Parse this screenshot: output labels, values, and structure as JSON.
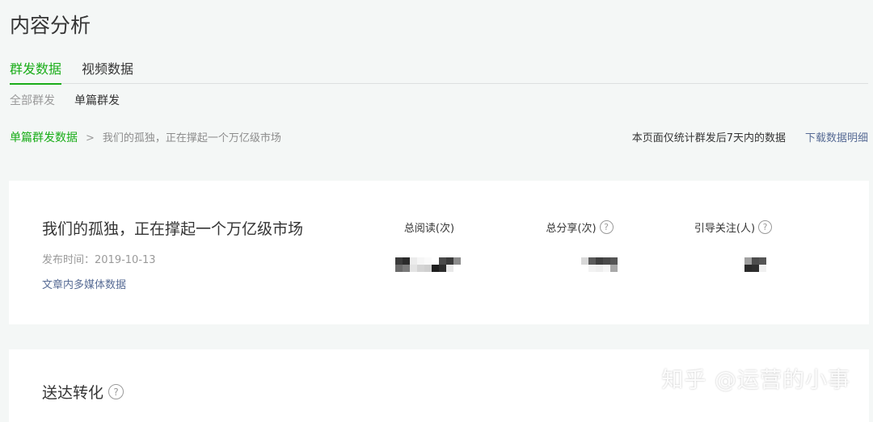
{
  "page": {
    "title": "内容分析"
  },
  "tabs": [
    {
      "label": "群发数据",
      "active": true
    },
    {
      "label": "视频数据",
      "active": false
    }
  ],
  "subtabs": [
    {
      "label": "全部群发",
      "active": false
    },
    {
      "label": "单篇群发",
      "active": true
    }
  ],
  "breadcrumb": {
    "parent": "单篇群发数据",
    "separator": ">",
    "current": "我们的孤独，正在撑起一个万亿级市场"
  },
  "header_note": "本页面仅统计群发后7天内的数据",
  "download_label": "下载数据明细",
  "article": {
    "title": "我们的孤独，正在撑起一个万亿级市场",
    "publish_label": "发布时间：",
    "publish_date": "2019-10-13",
    "media_link": "文章内多媒体数据"
  },
  "stats": [
    {
      "label": "总阅读(次)",
      "has_help": false
    },
    {
      "label": "总分享(次)",
      "has_help": true
    },
    {
      "label": "引导关注(人)",
      "has_help": true
    }
  ],
  "section": {
    "title": "送达转化",
    "has_help": true
  },
  "help_glyph": "?",
  "watermark": "知乎 @运营的小事",
  "colors": {
    "accent": "#1aad19",
    "link": "#576b95",
    "background": "#f4f7f6"
  }
}
